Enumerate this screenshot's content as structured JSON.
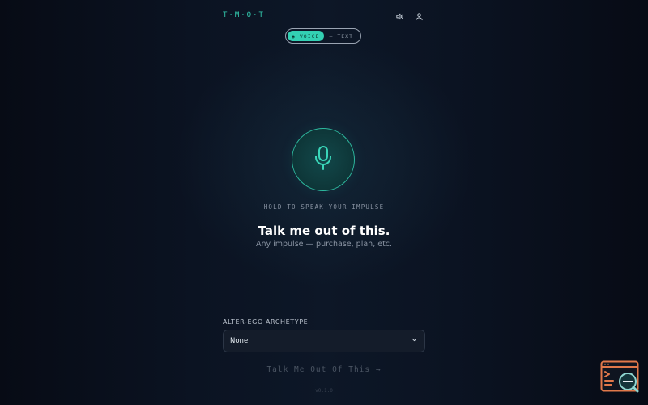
{
  "header": {
    "logo": "T·M·O·T",
    "icons": [
      "speaker-icon",
      "user-icon"
    ]
  },
  "mode_toggle": {
    "voice_label": "◉ VOICE",
    "text_label": "— TEXT",
    "selected": "voice"
  },
  "mic": {
    "icon": "microphone-icon",
    "hint": "HOLD TO SPEAK YOUR IMPULSE"
  },
  "main": {
    "title": "Talk me out of this.",
    "subtitle": "Any impulse — purchase, plan, etc."
  },
  "archetype": {
    "label": "ALTER-EGO ARCHETYPE",
    "selected": "None"
  },
  "submit_label": "Talk Me Out Of This →",
  "version": "v0.1.0",
  "colors": {
    "accent": "#33d0b3",
    "background": "#0b1322",
    "select_bg": "#141c2a",
    "widget_orange": "#e0784a"
  }
}
